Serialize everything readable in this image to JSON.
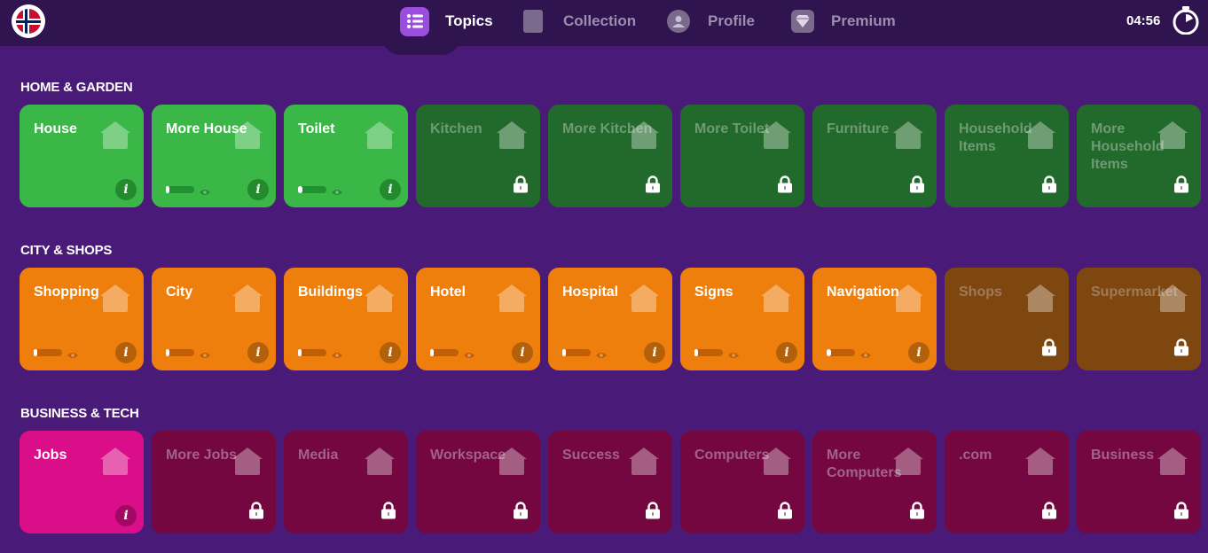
{
  "header": {
    "nav": [
      {
        "label": "Topics",
        "icon": "list-icon",
        "active": true
      },
      {
        "label": "Collection",
        "icon": "book-icon",
        "active": false
      },
      {
        "label": "Profile",
        "icon": "user-icon",
        "active": false
      },
      {
        "label": "Premium",
        "icon": "diamond-icon",
        "active": false
      }
    ],
    "timer": "04:56"
  },
  "sections": [
    {
      "title": "HOME & GARDEN",
      "color": "#3ab747",
      "cards": [
        {
          "label": "House",
          "state": "unlocked",
          "progress": null
        },
        {
          "label": "More House",
          "state": "unlocked",
          "progress": 0.1
        },
        {
          "label": "Toilet",
          "state": "unlocked",
          "progress": 0.15
        },
        {
          "label": "Kitchen",
          "state": "locked"
        },
        {
          "label": "More Kitchen",
          "state": "locked"
        },
        {
          "label": "More Toilet",
          "state": "locked"
        },
        {
          "label": "Furniture",
          "state": "locked"
        },
        {
          "label": "Household Items",
          "state": "locked"
        },
        {
          "label": "More Household Items",
          "state": "locked"
        }
      ]
    },
    {
      "title": "CITY & SHOPS",
      "color": "#ef7f0d",
      "cards": [
        {
          "label": "Shopping",
          "state": "unlocked",
          "progress": 0.1
        },
        {
          "label": "City",
          "state": "unlocked",
          "progress": 0.1
        },
        {
          "label": "Buildings",
          "state": "unlocked",
          "progress": 0.1
        },
        {
          "label": "Hotel",
          "state": "unlocked",
          "progress": 0.1
        },
        {
          "label": "Hospital",
          "state": "unlocked",
          "progress": 0.1
        },
        {
          "label": "Signs",
          "state": "unlocked",
          "progress": 0.1
        },
        {
          "label": "Navigation",
          "state": "unlocked",
          "progress": 0.15
        },
        {
          "label": "Shops",
          "state": "locked"
        },
        {
          "label": "Supermarket",
          "state": "locked"
        }
      ]
    },
    {
      "title": "BUSINESS & TECH",
      "color": "#d90e88",
      "cards": [
        {
          "label": "Jobs",
          "state": "unlocked",
          "progress": null
        },
        {
          "label": "More Jobs",
          "state": "locked"
        },
        {
          "label": "Media",
          "state": "locked"
        },
        {
          "label": "Workspace",
          "state": "locked"
        },
        {
          "label": "Success",
          "state": "locked"
        },
        {
          "label": "Computers",
          "state": "locked"
        },
        {
          "label": "More Computers",
          "state": "locked"
        },
        {
          "label": ".com",
          "state": "locked"
        },
        {
          "label": "Business",
          "state": "locked"
        }
      ]
    }
  ]
}
